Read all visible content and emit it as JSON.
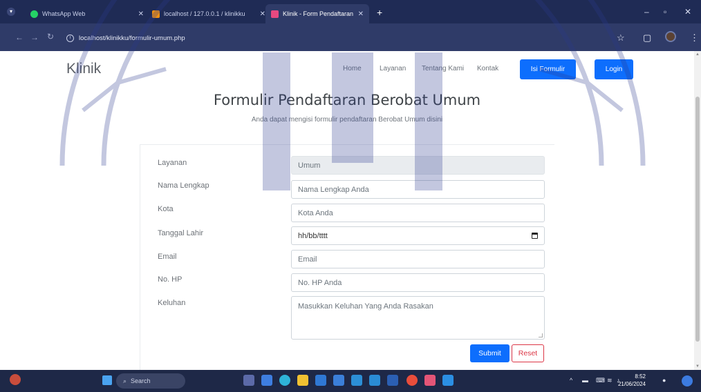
{
  "browser": {
    "tabs": [
      {
        "label": "WhatsApp Web",
        "color": "#25d366"
      },
      {
        "label": "localhost / 127.0.0.1 / klinikku",
        "color": "#f29111"
      },
      {
        "label": "Klinik - Form Pendaftaran",
        "color": "#3b5bdb",
        "active": true
      }
    ],
    "new_tab": "+",
    "window_controls": [
      "–",
      "▫",
      "✕"
    ],
    "url": "localhost/klinikku/formulir-umum.php",
    "nav_icons": [
      "back-icon",
      "forward-icon",
      "reload-icon"
    ],
    "right_icons": [
      "star-icon",
      "extensions-icon",
      "profile-icon",
      "menu-icon"
    ]
  },
  "site": {
    "brand": "Klinik",
    "nav": [
      "Home",
      "Layanan",
      "Tentang Kami",
      "Kontak"
    ],
    "isi_formulir": "Isi Formulir",
    "login": "Login"
  },
  "form": {
    "title": "Formulir Pendaftaran Berobat Umum",
    "subtitle": "Anda dapat mengisi formulir pendaftaran Berobat Umum disini",
    "fields": {
      "layanan": {
        "label": "Layanan",
        "value": "Umum"
      },
      "nama": {
        "label": "Nama Lengkap",
        "placeholder": "Nama Lengkap Anda"
      },
      "kota": {
        "label": "Kota",
        "placeholder": "Kota Anda"
      },
      "tanggal": {
        "label": "Tanggal Lahir",
        "placeholder": "hh/bb/tttt"
      },
      "email": {
        "label": "Email",
        "placeholder": "Email"
      },
      "hp": {
        "label": "No. HP",
        "placeholder": "No. HP Anda"
      },
      "keluhan": {
        "label": "Keluhan",
        "placeholder": "Masukkan Keluhan Yang Anda Rasakan"
      }
    },
    "submit": "Submit",
    "reset": "Reset"
  },
  "taskbar": {
    "search": "Search",
    "time": "8:52",
    "date": "21/06/2024"
  },
  "colors": {
    "primary": "#0d6efd",
    "danger": "#dc3545",
    "chrome_dark": "#1f2b55"
  }
}
